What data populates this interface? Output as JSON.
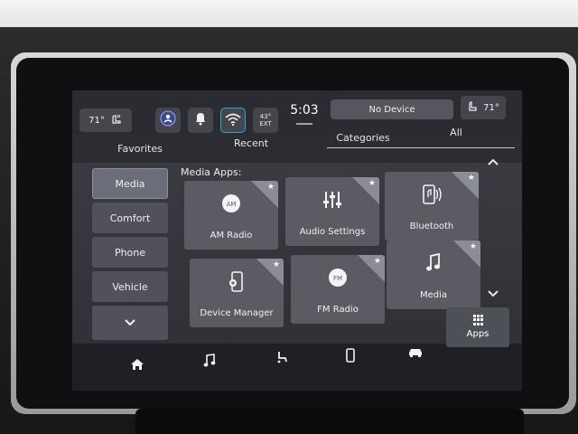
{
  "status": {
    "temp_left": "71°",
    "temp_right": "71°",
    "outside_temp_value": "43°",
    "outside_temp_label": "EXT",
    "time": "5:03",
    "device": "No Device"
  },
  "tabs": [
    {
      "label": "Favorites"
    },
    {
      "label": "Recent"
    },
    {
      "label": "Categories"
    },
    {
      "label": "All"
    }
  ],
  "sidebar": {
    "items": [
      {
        "label": "Media"
      },
      {
        "label": "Comfort"
      },
      {
        "label": "Phone"
      },
      {
        "label": "Vehicle"
      }
    ]
  },
  "main": {
    "section_title": "Media Apps:",
    "tiles": [
      {
        "label": "AM Radio",
        "icon": "AM"
      },
      {
        "label": "Audio Settings",
        "icon": "equalizer"
      },
      {
        "label": "Bluetooth",
        "icon": "bluetooth-audio"
      },
      {
        "label": "Device Manager",
        "icon": "phone-device"
      },
      {
        "label": "FM Radio",
        "icon": "FM"
      },
      {
        "label": "Media",
        "icon": "music-note"
      }
    ]
  },
  "nav": {
    "apps_label": "Apps"
  },
  "colors": {
    "screen_bg": "#2c2d33",
    "tile_bg": "#5a5b63",
    "nav_bg": "#1f2025"
  }
}
